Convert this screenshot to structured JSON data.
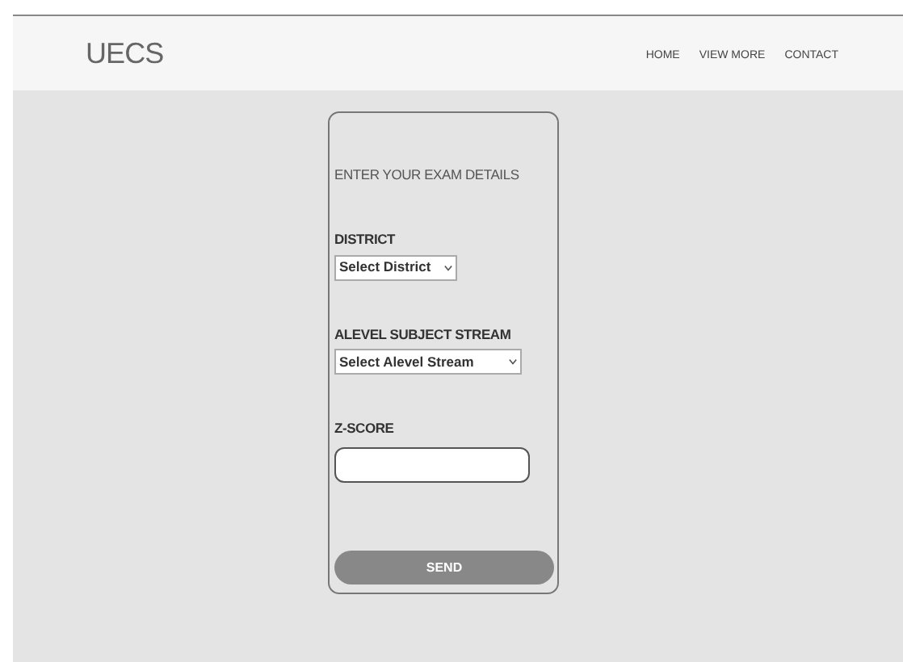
{
  "header": {
    "logo": "UECS",
    "nav": [
      "HOME",
      "VIEW MORE",
      "CONTACT"
    ]
  },
  "form": {
    "title": "ENTER YOUR EXAM DETAILS",
    "fields": [
      {
        "kind": "select",
        "label": "DISTRICT",
        "value": "Select District"
      },
      {
        "kind": "select",
        "label": "ALEVEL SUBJECT STREAM",
        "value": "Select Alevel Stream"
      },
      {
        "kind": "text",
        "label": "Z-SCORE"
      }
    ],
    "button": "SEND"
  }
}
